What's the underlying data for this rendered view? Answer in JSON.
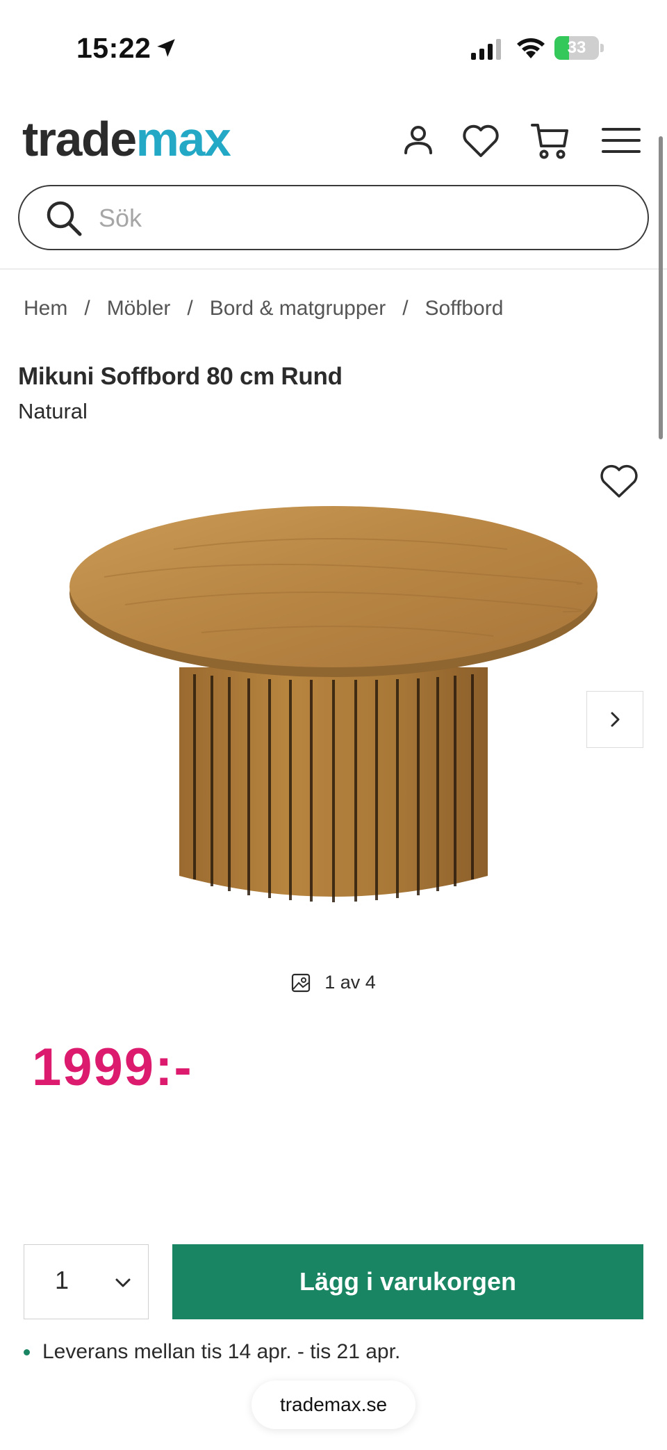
{
  "status_bar": {
    "time": "15:22",
    "battery": "33",
    "battery_percent": 33
  },
  "header": {
    "logo_part_a": "trade",
    "logo_part_b": "max",
    "icons": [
      "user-icon",
      "heart-icon",
      "cart-icon",
      "menu-icon"
    ],
    "brand_color": "#23a9c6"
  },
  "search": {
    "placeholder": "Sök",
    "value": ""
  },
  "breadcrumb": {
    "items": [
      "Hem",
      "Möbler",
      "Bord & matgrupper",
      "Soffbord"
    ],
    "separator": "/"
  },
  "product": {
    "title": "Mikuni Soffbord 80 cm Rund",
    "variant": "Natural",
    "image_counter": "1 av 4",
    "price": "1999:-",
    "price_color": "#dc1a6e"
  },
  "purchase": {
    "quantity": "1",
    "add_to_cart": "Lägg i varukorgen",
    "button_color": "#1a8562",
    "delivery": "Leverans mellan tis 14 apr. - tis 21 apr."
  },
  "browser": {
    "url": "trademax.se"
  }
}
